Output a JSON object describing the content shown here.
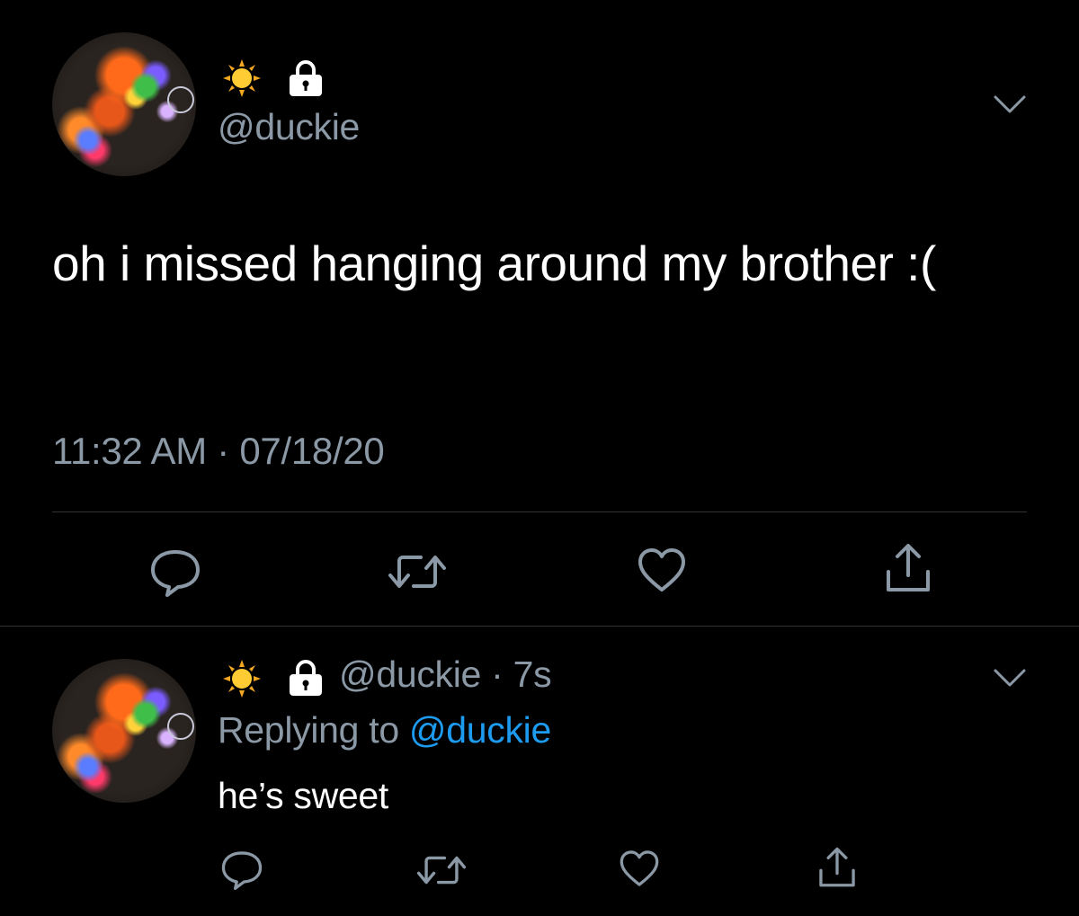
{
  "colors": {
    "background": "#000000",
    "primary_text": "#ffffff",
    "secondary_text": "#8b98a5",
    "link": "#1d9bf0",
    "divider": "#2f3336",
    "icon": "#8b98a5"
  },
  "main_tweet": {
    "display_name_icons": [
      "sun-emoji-icon",
      "lock-icon"
    ],
    "handle": "@duckie",
    "text": "oh i missed hanging around my brother :(",
    "time": "11:32 AM · 07/18/20",
    "actions": [
      "reply-icon",
      "retweet-icon",
      "like-icon",
      "share-icon"
    ]
  },
  "reply_tweet": {
    "display_name_icons": [
      "sun-emoji-icon",
      "lock-icon"
    ],
    "handle_and_age": "@duckie · 7s",
    "replying_label": "Replying to",
    "replying_to": "@duckie",
    "text": "he’s sweet",
    "actions": [
      "reply-icon",
      "retweet-icon",
      "like-icon",
      "share-icon"
    ]
  }
}
